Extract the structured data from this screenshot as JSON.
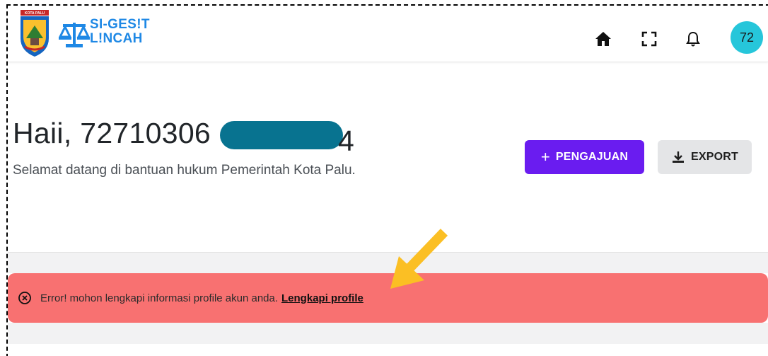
{
  "header": {
    "logo": {
      "seal_label": "KOTA PALU",
      "line1": "SI-GES!T",
      "line2": "L!NCAH"
    },
    "nav": [
      {
        "name": "home-icon"
      },
      {
        "name": "fullscreen-icon"
      },
      {
        "name": "bell-icon"
      }
    ],
    "avatar_text": "72"
  },
  "main": {
    "greeting_prefix": "Haii, 72710306",
    "greeting_suffix": "4",
    "subtitle": "Selamat datang di bantuan hukum Pemerintah Kota Palu.",
    "buttons": {
      "pengajuan_icon": "+",
      "pengajuan_label": "PENGAJUAN",
      "export_label": "EXPORT"
    }
  },
  "alert": {
    "message": "Error! mohon lengkapi informasi profile akun anda.",
    "link_label": "Lengkapi profile"
  },
  "colors": {
    "primary": "#6a1cf0",
    "alert_bg": "#f87171",
    "avatar_bg": "#26c6da",
    "redaction": "#087390",
    "arrow": "#fbbf24"
  }
}
